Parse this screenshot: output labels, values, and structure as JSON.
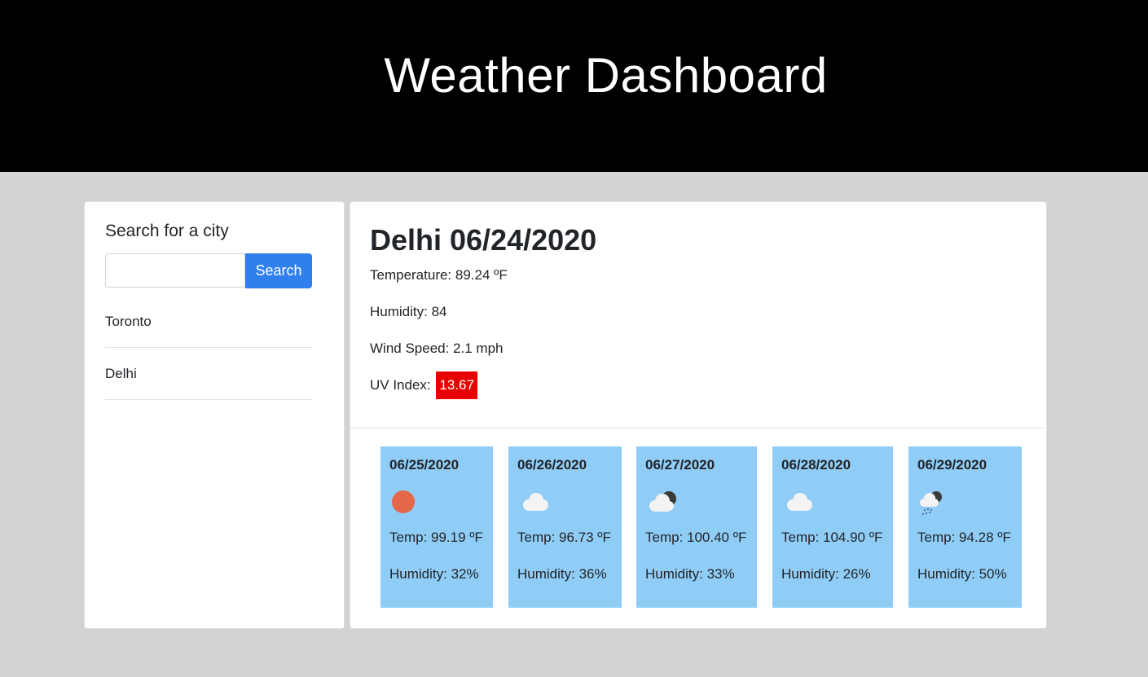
{
  "header": {
    "title": "Weather Dashboard"
  },
  "search": {
    "heading": "Search for a city",
    "input_value": "",
    "placeholder": "",
    "button_label": "Search",
    "history": [
      "Toronto",
      "Delhi"
    ]
  },
  "current": {
    "title": "Delhi 06/24/2020",
    "temperature": "Temperature: 89.24 ºF",
    "humidity": "Humidity: 84",
    "wind": "Wind Speed: 2.1 mph",
    "uv_label": "UV Index: ",
    "uv_value": "13.67",
    "uv_color": "#e80000"
  },
  "forecast": [
    {
      "date": "06/25/2020",
      "icon": "sun-icon",
      "temp": "Temp: 99.19 ºF",
      "humidity": "Humidity: 32%"
    },
    {
      "date": "06/26/2020",
      "icon": "cloud-icon",
      "temp": "Temp: 96.73 ºF",
      "humidity": "Humidity: 36%"
    },
    {
      "date": "06/27/2020",
      "icon": "cloud-moon-icon",
      "temp": "Temp: 100.40 ºF",
      "humidity": "Humidity: 33%"
    },
    {
      "date": "06/28/2020",
      "icon": "cloud-icon",
      "temp": "Temp: 104.90 ºF",
      "humidity": "Humidity: 26%"
    },
    {
      "date": "06/29/2020",
      "icon": "rain-night-icon",
      "temp": "Temp: 94.28 ºF",
      "humidity": "Humidity: 50%"
    }
  ],
  "colors": {
    "header_bg": "#000000",
    "page_bg": "#d3d3d3",
    "accent": "#2f80ed",
    "forecast_bg": "#90cdf6"
  }
}
